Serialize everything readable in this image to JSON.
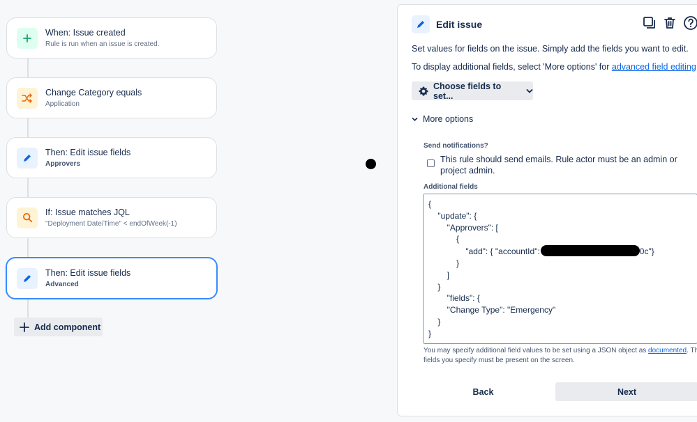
{
  "rule": {
    "cards": [
      {
        "title": "When: Issue created",
        "subtitle": "Rule is run when an issue is created.",
        "icon": "plus-icon"
      },
      {
        "title": "Change Category equals",
        "subtitle": "Application",
        "icon": "branch-shuffle-icon"
      },
      {
        "title": "Then: Edit issue fields",
        "subtitle": "Approvers",
        "icon": "pencil-icon"
      },
      {
        "title": "If: Issue matches JQL",
        "subtitle": "\"Deployment Date/Time\" < endOfWeek(-1)",
        "icon": "search-icon"
      },
      {
        "title": "Then: Edit issue fields",
        "subtitle": "Advanced",
        "icon": "pencil-icon"
      }
    ],
    "add_component_label": "Add component"
  },
  "panel": {
    "title": "Edit issue",
    "description": "Set values for fields on the issue. Simply add the fields you want to edit.",
    "display_hint_prefix": "To display additional fields, select 'More options' for ",
    "display_hint_link": "advanced field editing",
    "display_hint_suffix": ".",
    "choose_fields_label": "Choose fields to set...",
    "more_options_label": "More options",
    "send_notifications_label": "Send notifications?",
    "send_notifications_text": "This rule should send emails. Rule actor must be an admin or project admin.",
    "additional_fields_label": "Additional fields",
    "json_lines": [
      "{",
      "    \"update\": {",
      "        \"Approvers\": [",
      "            {",
      "                \"add\": { \"accountId\":",
      "            }",
      "        ]",
      "    }",
      "        \"fields\": {",
      "        \"Change Type\": \"Emergency\"",
      "    }",
      "}"
    ],
    "json_add_suffix": "0c\"}",
    "help_prefix": "You may specify additional field values to be set using a JSON object as ",
    "help_link": "documented",
    "help_suffix": ". The fields you specify must be present on the screen.",
    "back_label": "Back",
    "next_label": "Next"
  },
  "colors": {
    "accent": "#0c66e4",
    "selected_border": "#388bff",
    "green_icon": "#22a06b",
    "orange_icon": "#e56910"
  }
}
